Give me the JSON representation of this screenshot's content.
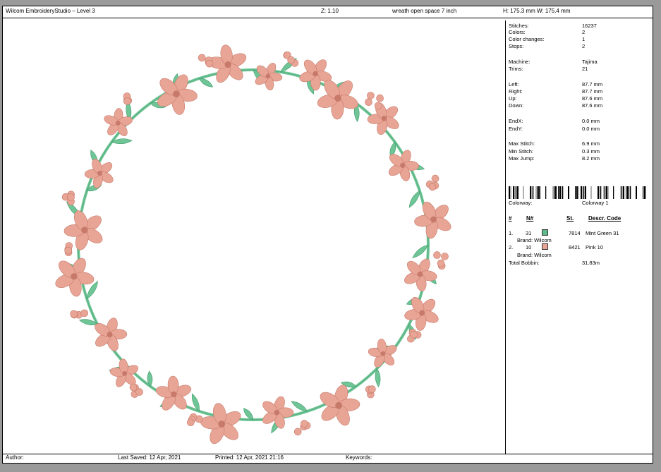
{
  "header": {
    "app_title": "Wilcom EmbroideryStudio – Level 3",
    "zoom": "Z: 1.10",
    "design_name": "wreath open space 7 inch",
    "height": "H: 175.3 mm",
    "width": "W: 175.4 mm"
  },
  "stats": [
    {
      "label": "Stitches:",
      "value": "16237"
    },
    {
      "label": "Colors:",
      "value": "2"
    },
    {
      "label": "Color changes:",
      "value": "1"
    },
    {
      "label": "Stops:",
      "value": "2"
    },
    {
      "label": "Machine:",
      "value": "Tajima"
    },
    {
      "label": "Trims:",
      "value": "21"
    },
    {
      "label": "Left:",
      "value": "87.7 mm"
    },
    {
      "label": "Right:",
      "value": "87.7 mm"
    },
    {
      "label": "Up:",
      "value": "87.6 mm"
    },
    {
      "label": "Down:",
      "value": "87.6 mm"
    },
    {
      "label": "EndX:",
      "value": "0.0 mm"
    },
    {
      "label": "EndY:",
      "value": "0.0 mm"
    },
    {
      "label": "Max Stitch:",
      "value": "6.9 mm"
    },
    {
      "label": "Min Stitch:",
      "value": "0.3 mm"
    },
    {
      "label": "Max Jump:",
      "value": "8.2 mm"
    }
  ],
  "colorway": {
    "label": "Colorway:",
    "value": "Colorway 1"
  },
  "table": {
    "headers": {
      "idx": "#",
      "num": "N#",
      "st": "St.",
      "desc": "Descr. Code"
    },
    "rows": [
      {
        "idx": "1.",
        "num": "31",
        "color": "#5fb98a",
        "st": "7814",
        "desc": "Mint Green 31",
        "brand": "Brand: Wilcom"
      },
      {
        "idx": "2.",
        "num": "10",
        "color": "#e8a596",
        "st": "8421",
        "desc": "Pink 10",
        "brand": "Brand: Wilcom"
      }
    ],
    "total_label": "Total Bobbin:",
    "total_value": "31.83m"
  },
  "footer": {
    "author": "Author:",
    "last_saved": "Last Saved: 12 Apr, 2021",
    "printed": "Printed: 12 Apr, 2021 21:16",
    "keywords": "Keywords:"
  },
  "design_colors": {
    "leaf": "#6fc596",
    "leaf_dark": "#3f9a6c",
    "flower": "#e8a596",
    "flower_dark": "#c77a6a"
  }
}
